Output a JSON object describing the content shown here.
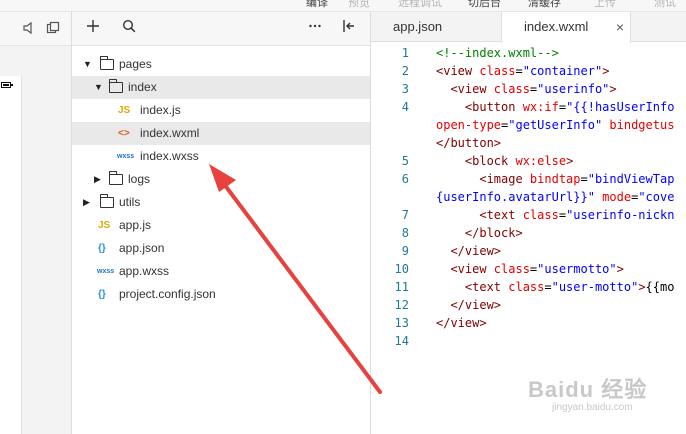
{
  "toolbar": {
    "items": [
      "编译",
      "预览",
      "远程调试",
      "切后台",
      "清缓存",
      "上传",
      "测试"
    ]
  },
  "explorer": {
    "tree": [
      {
        "label": "pages",
        "kind": "folder",
        "expanded": true,
        "depth": 0
      },
      {
        "label": "index",
        "kind": "folder",
        "expanded": true,
        "depth": 1
      },
      {
        "label": "index.js",
        "kind": "file",
        "icon": "JS",
        "depth": 2
      },
      {
        "label": "index.wxml",
        "kind": "file",
        "icon": "<>",
        "depth": 2
      },
      {
        "label": "index.wxss",
        "kind": "file",
        "icon": "wxss",
        "depth": 2
      },
      {
        "label": "logs",
        "kind": "folder",
        "expanded": false,
        "depth": 1
      },
      {
        "label": "utils",
        "kind": "folder",
        "expanded": false,
        "depth": 0
      },
      {
        "label": "app.js",
        "kind": "file",
        "icon": "JS",
        "depth": 0
      },
      {
        "label": "app.json",
        "kind": "file",
        "icon": "{}",
        "depth": 0
      },
      {
        "label": "app.wxss",
        "kind": "file",
        "icon": "wxss",
        "depth": 0
      },
      {
        "label": "project.config.json",
        "kind": "file",
        "icon": "{}",
        "depth": 0
      }
    ]
  },
  "editor": {
    "tabs": [
      {
        "label": "app.json",
        "active": false
      },
      {
        "label": "index.wxml",
        "active": true,
        "close": "×"
      }
    ],
    "lines": [
      {
        "n": "1",
        "segs": [
          [
            "com",
            "<!--index.wxml-->"
          ]
        ]
      },
      {
        "n": "2",
        "segs": [
          [
            "tag",
            "<view "
          ],
          [
            "attr",
            "class"
          ],
          [
            "txt",
            "="
          ],
          [
            "str",
            "\"container\""
          ],
          [
            "tag",
            ">"
          ]
        ]
      },
      {
        "n": "3",
        "segs": [
          [
            "tag",
            "  <view "
          ],
          [
            "attr",
            "class"
          ],
          [
            "txt",
            "="
          ],
          [
            "str",
            "\"userinfo\""
          ],
          [
            "tag",
            ">"
          ]
        ]
      },
      {
        "n": "4",
        "segs": [
          [
            "tag",
            "    <button "
          ],
          [
            "attr",
            "wx:if"
          ],
          [
            "txt",
            "="
          ],
          [
            "str",
            "\"{{!hasUserInfo"
          ]
        ]
      },
      {
        "n": "",
        "segs": [
          [
            "attr",
            "open-type"
          ],
          [
            "txt",
            "="
          ],
          [
            "str",
            "\"getUserInfo\""
          ],
          [
            "attr",
            " bindgetus"
          ]
        ]
      },
      {
        "n": "",
        "segs": [
          [
            "tag",
            "</button>"
          ]
        ]
      },
      {
        "n": "5",
        "segs": [
          [
            "tag",
            "    <block "
          ],
          [
            "attr",
            "wx:else"
          ],
          [
            "tag",
            ">"
          ]
        ]
      },
      {
        "n": "6",
        "segs": [
          [
            "tag",
            "      <image "
          ],
          [
            "attr",
            "bindtap"
          ],
          [
            "txt",
            "="
          ],
          [
            "str",
            "\"bindViewTap"
          ]
        ]
      },
      {
        "n": "",
        "segs": [
          [
            "str",
            "{userInfo.avatarUrl}}\""
          ],
          [
            "attr",
            " mode"
          ],
          [
            "txt",
            "="
          ],
          [
            "str",
            "\"cove"
          ]
        ]
      },
      {
        "n": "7",
        "segs": [
          [
            "tag",
            "      <text "
          ],
          [
            "attr",
            "class"
          ],
          [
            "txt",
            "="
          ],
          [
            "str",
            "\"userinfo-nickn"
          ]
        ]
      },
      {
        "n": "8",
        "segs": [
          [
            "tag",
            "    </block>"
          ]
        ]
      },
      {
        "n": "9",
        "segs": [
          [
            "tag",
            "  </view>"
          ]
        ]
      },
      {
        "n": "10",
        "segs": [
          [
            "tag",
            "  <view "
          ],
          [
            "attr",
            "class"
          ],
          [
            "txt",
            "="
          ],
          [
            "str",
            "\"usermotto\""
          ],
          [
            "tag",
            ">"
          ]
        ]
      },
      {
        "n": "11",
        "segs": [
          [
            "tag",
            "    <text "
          ],
          [
            "attr",
            "class"
          ],
          [
            "txt",
            "="
          ],
          [
            "str",
            "\"user-motto\""
          ],
          [
            "tag",
            ">"
          ],
          [
            "txt",
            "{{mo"
          ]
        ]
      },
      {
        "n": "12",
        "segs": [
          [
            "tag",
            "  </view>"
          ]
        ]
      },
      {
        "n": "13",
        "segs": [
          [
            "tag",
            "</view>"
          ]
        ]
      },
      {
        "n": "14",
        "segs": []
      }
    ]
  },
  "watermark": {
    "brand": "Baidu 经验",
    "url": "jingyan.baidu.com"
  },
  "colors": {
    "annotation": "#e8423f"
  }
}
